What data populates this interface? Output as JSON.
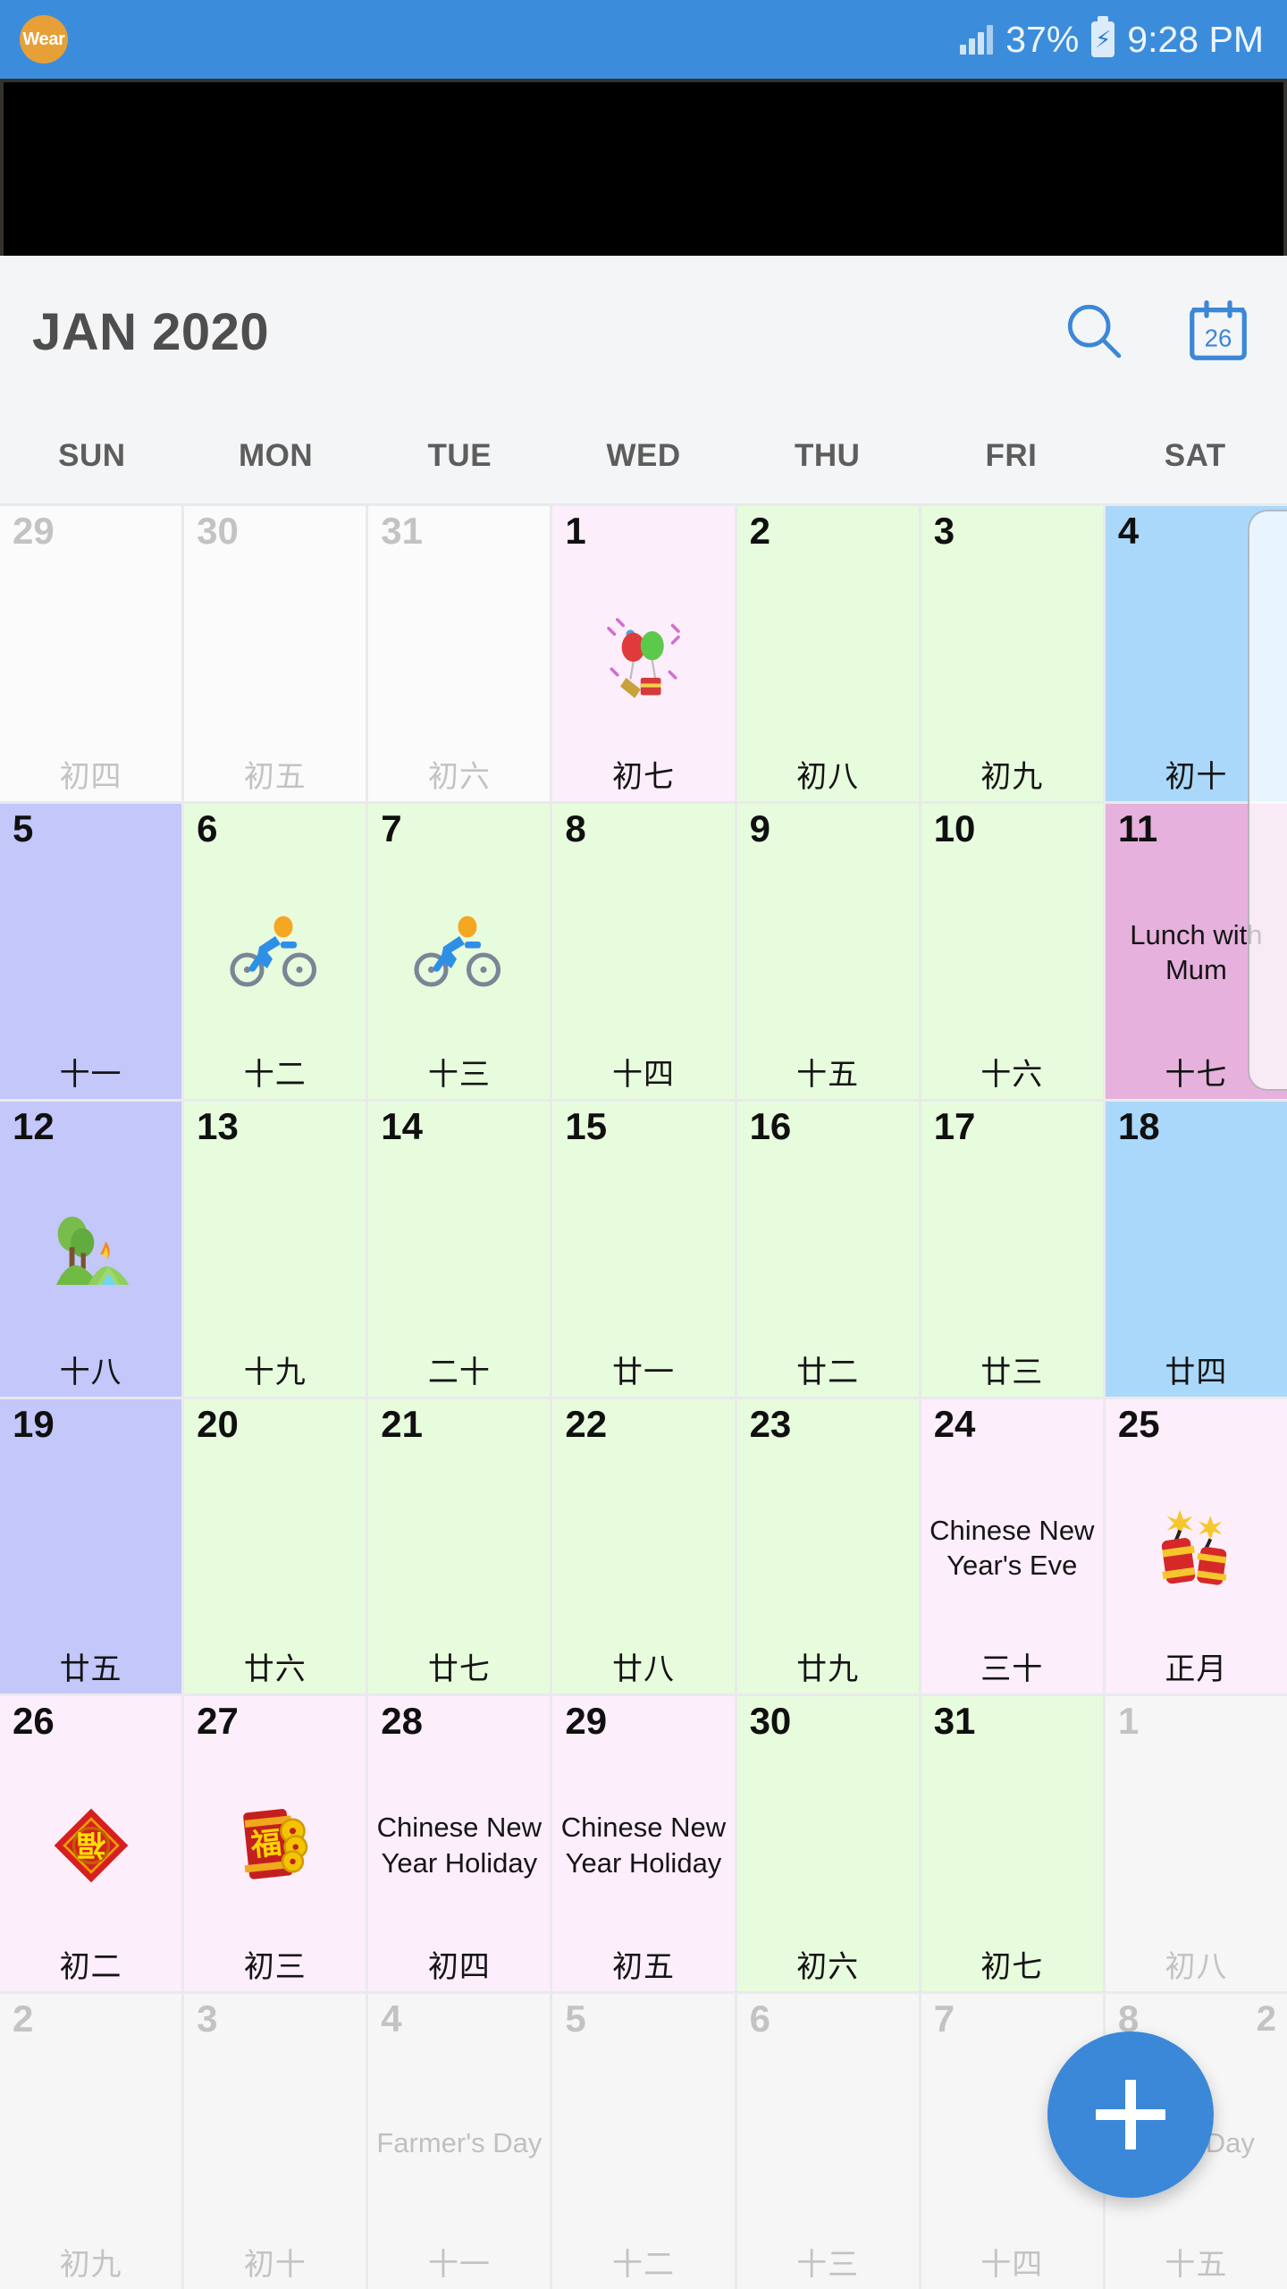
{
  "status_bar": {
    "wear_badge": "Wear",
    "signal_icon": "signal-bars-icon",
    "battery_percent": "37%",
    "battery_icon": "battery-charging-icon",
    "time": "9:28 PM"
  },
  "toolbar": {
    "month_title": "JAN 2020",
    "search_icon": "search-icon",
    "today_icon": "calendar-today-icon",
    "today_icon_number": "26"
  },
  "weekdays": [
    "SUN",
    "MON",
    "TUE",
    "WED",
    "THU",
    "FRI",
    "SAT"
  ],
  "colors": {
    "accent": "#3b87d8",
    "status_bar": "#3b8ddb",
    "page_bg": "#f4f5f7",
    "weekend_blue": "#aad8fa",
    "sunday_indigo": "#c3c7f9",
    "workday_green": "#e7fbdd",
    "holiday_pink": "#fdeefb",
    "event_magenta": "#e6b1dd",
    "muted_text": "#c3c3c4"
  },
  "fab": {
    "label": "add-event",
    "icon": "plus-icon"
  },
  "overflow_badge": "2",
  "cells": [
    {
      "day": "29",
      "lunar": "初四",
      "bg": "bg-white",
      "muted": true,
      "event": "",
      "emoji": ""
    },
    {
      "day": "30",
      "lunar": "初五",
      "bg": "bg-white",
      "muted": true,
      "event": "",
      "emoji": ""
    },
    {
      "day": "31",
      "lunar": "初六",
      "bg": "bg-white",
      "muted": true,
      "event": "",
      "emoji": ""
    },
    {
      "day": "1",
      "lunar": "初七",
      "bg": "bg-pink",
      "muted": false,
      "event": "",
      "emoji": "party-popper-balloons-icon"
    },
    {
      "day": "2",
      "lunar": "初八",
      "bg": "bg-green",
      "muted": false,
      "event": "",
      "emoji": ""
    },
    {
      "day": "3",
      "lunar": "初九",
      "bg": "bg-green",
      "muted": false,
      "event": "",
      "emoji": ""
    },
    {
      "day": "4",
      "lunar": "初十",
      "bg": "bg-blue",
      "muted": false,
      "event": "",
      "emoji": ""
    },
    {
      "day": "5",
      "lunar": "十一",
      "bg": "bg-indigo",
      "muted": false,
      "event": "",
      "emoji": ""
    },
    {
      "day": "6",
      "lunar": "十二",
      "bg": "bg-green",
      "muted": false,
      "event": "",
      "emoji": "cyclist-icon"
    },
    {
      "day": "7",
      "lunar": "十三",
      "bg": "bg-green",
      "muted": false,
      "event": "",
      "emoji": "cyclist-icon"
    },
    {
      "day": "8",
      "lunar": "十四",
      "bg": "bg-green",
      "muted": false,
      "event": "",
      "emoji": ""
    },
    {
      "day": "9",
      "lunar": "十五",
      "bg": "bg-green",
      "muted": false,
      "event": "",
      "emoji": ""
    },
    {
      "day": "10",
      "lunar": "十六",
      "bg": "bg-green",
      "muted": false,
      "event": "",
      "emoji": ""
    },
    {
      "day": "11",
      "lunar": "十七",
      "bg": "bg-magenta",
      "muted": false,
      "event": "Lunch with Mum",
      "emoji": ""
    },
    {
      "day": "12",
      "lunar": "十八",
      "bg": "bg-indigo",
      "muted": false,
      "event": "",
      "emoji": "camping-icon"
    },
    {
      "day": "13",
      "lunar": "十九",
      "bg": "bg-green",
      "muted": false,
      "event": "",
      "emoji": ""
    },
    {
      "day": "14",
      "lunar": "二十",
      "bg": "bg-green",
      "muted": false,
      "event": "",
      "emoji": ""
    },
    {
      "day": "15",
      "lunar": "廿一",
      "bg": "bg-green",
      "muted": false,
      "event": "",
      "emoji": ""
    },
    {
      "day": "16",
      "lunar": "廿二",
      "bg": "bg-green",
      "muted": false,
      "event": "",
      "emoji": ""
    },
    {
      "day": "17",
      "lunar": "廿三",
      "bg": "bg-green",
      "muted": false,
      "event": "",
      "emoji": ""
    },
    {
      "day": "18",
      "lunar": "廿四",
      "bg": "bg-blue",
      "muted": false,
      "event": "",
      "emoji": ""
    },
    {
      "day": "19",
      "lunar": "廿五",
      "bg": "bg-indigo",
      "muted": false,
      "event": "",
      "emoji": ""
    },
    {
      "day": "20",
      "lunar": "廿六",
      "bg": "bg-green",
      "muted": false,
      "event": "",
      "emoji": ""
    },
    {
      "day": "21",
      "lunar": "廿七",
      "bg": "bg-green",
      "muted": false,
      "event": "",
      "emoji": ""
    },
    {
      "day": "22",
      "lunar": "廿八",
      "bg": "bg-green",
      "muted": false,
      "event": "",
      "emoji": ""
    },
    {
      "day": "23",
      "lunar": "廿九",
      "bg": "bg-green",
      "muted": false,
      "event": "",
      "emoji": ""
    },
    {
      "day": "24",
      "lunar": "三十",
      "bg": "bg-pink",
      "muted": false,
      "event": "Chinese New Year's Eve",
      "emoji": ""
    },
    {
      "day": "25",
      "lunar": "正月",
      "bg": "bg-pink",
      "muted": false,
      "event": "",
      "emoji": "firecracker-icon"
    },
    {
      "day": "26",
      "lunar": "初二",
      "bg": "bg-pink",
      "muted": false,
      "event": "",
      "emoji": "fu-diamond-icon"
    },
    {
      "day": "27",
      "lunar": "初三",
      "bg": "bg-pink",
      "muted": false,
      "event": "",
      "emoji": "red-envelope-icon"
    },
    {
      "day": "28",
      "lunar": "初四",
      "bg": "bg-pink",
      "muted": false,
      "event": "Chinese New Year Holiday",
      "emoji": ""
    },
    {
      "day": "29",
      "lunar": "初五",
      "bg": "bg-pink",
      "muted": false,
      "event": "Chinese New Year Holiday",
      "emoji": ""
    },
    {
      "day": "30",
      "lunar": "初六",
      "bg": "bg-green",
      "muted": false,
      "event": "",
      "emoji": ""
    },
    {
      "day": "31",
      "lunar": "初七",
      "bg": "bg-green",
      "muted": false,
      "event": "",
      "emoji": ""
    },
    {
      "day": "1",
      "lunar": "初八",
      "bg": "bg-grey",
      "muted": true,
      "event": "",
      "emoji": ""
    },
    {
      "day": "2",
      "lunar": "初九",
      "bg": "bg-grey",
      "muted": true,
      "event": "",
      "emoji": ""
    },
    {
      "day": "3",
      "lunar": "初十",
      "bg": "bg-grey",
      "muted": true,
      "event": "",
      "emoji": ""
    },
    {
      "day": "4",
      "lunar": "十一",
      "bg": "bg-grey",
      "muted": true,
      "event": "Farmer's Day",
      "emoji": ""
    },
    {
      "day": "5",
      "lunar": "十二",
      "bg": "bg-grey",
      "muted": true,
      "event": "",
      "emoji": ""
    },
    {
      "day": "6",
      "lunar": "十三",
      "bg": "bg-grey",
      "muted": true,
      "event": "",
      "emoji": ""
    },
    {
      "day": "7",
      "lunar": "十四",
      "bg": "bg-grey",
      "muted": true,
      "event": "",
      "emoji": ""
    },
    {
      "day": "8",
      "lunar": "十五",
      "bg": "bg-grey",
      "muted": true,
      "event": "Fe… Day",
      "emoji": ""
    }
  ]
}
